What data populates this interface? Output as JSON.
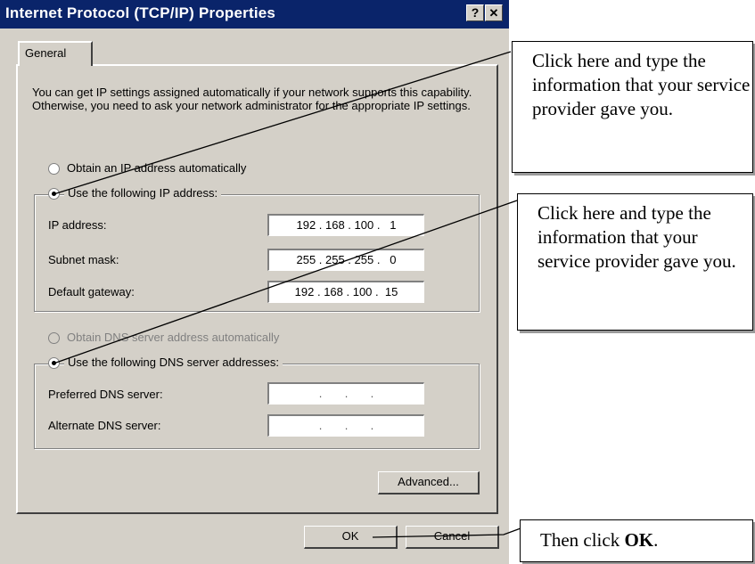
{
  "dialog": {
    "title": "Internet Protocol (TCP/IP) Properties",
    "help_button": "?",
    "close_button": "✕",
    "tab_general": "General",
    "description": "You can get IP settings assigned automatically if your network supports this capability. Otherwise, you need to ask your network administrator for the appropriate IP settings.",
    "ip": {
      "auto_label": "Obtain an IP address automatically",
      "auto_selected": false,
      "manual_label": "Use the following IP address:",
      "manual_selected": true,
      "ip_address_label": "IP address:",
      "ip_address_value": "192 . 168 . 100 .   1",
      "subnet_label": "Subnet mask:",
      "subnet_value": "255 . 255 . 255 .   0",
      "gateway_label": "Default gateway:",
      "gateway_value": "192 . 168 . 100 .  15"
    },
    "dns": {
      "auto_label": "Obtain DNS server address automatically",
      "auto_selected": false,
      "manual_label": "Use the following DNS server addresses:",
      "manual_selected": true,
      "preferred_label": "Preferred DNS server:",
      "preferred_value": " .       .       . ",
      "alternate_label": "Alternate DNS server:",
      "alternate_value": " .       .       . "
    },
    "advanced_button": "Advanced...",
    "ok_button": "OK",
    "cancel_button": "Cancel"
  },
  "callouts": {
    "note1": "Click here and type the information that your service provider gave you.",
    "note2": "Click here and type the information that your service provider gave you.",
    "note3_prefix": "Then click ",
    "note3_bold": "OK",
    "note3_suffix": "."
  },
  "colors": {
    "title_bar": "#0a246a",
    "dialog_face": "#d4d0c8"
  }
}
